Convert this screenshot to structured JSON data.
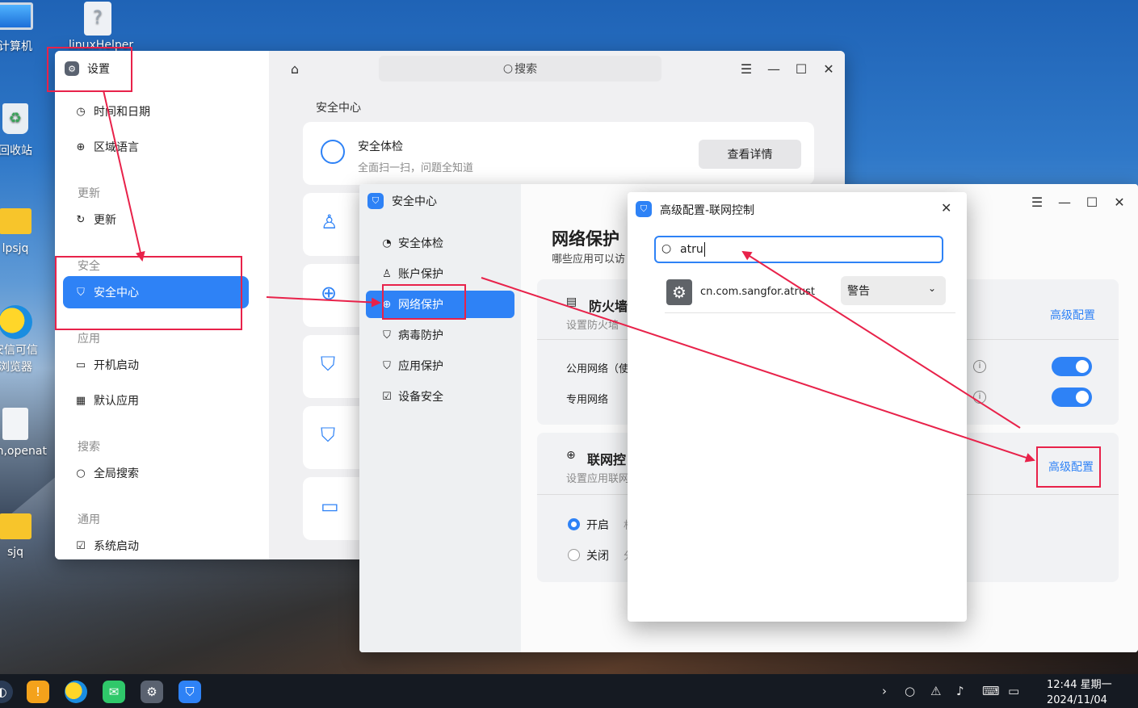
{
  "desktop": {
    "icons": [
      {
        "label": "计算机"
      },
      {
        "label": "linuxHelper"
      },
      {
        "label": "回收站"
      },
      {
        "label": "lpsjq"
      },
      {
        "label": "安信可信浏览器"
      },
      {
        "label": "en,openat"
      },
      {
        "label": "sjq"
      }
    ]
  },
  "settings": {
    "title": "设置",
    "search_placeholder": "搜索",
    "sidebar": {
      "items_top": [
        {
          "label": "时间和日期",
          "icon": "clock-icon"
        },
        {
          "label": "区域语言",
          "icon": "globe-icon"
        }
      ],
      "group_update": "更新",
      "update_item": "更新",
      "group_security": "安全",
      "security_item": "安全中心",
      "group_apps": "应用",
      "app_items": [
        {
          "label": "开机启动",
          "icon": "boot-icon"
        },
        {
          "label": "默认应用",
          "icon": "grid-icon"
        }
      ],
      "group_search": "搜索",
      "search_item": "全局搜索",
      "group_general": "通用",
      "general_item": "系统启动"
    },
    "main": {
      "section_title": "安全中心",
      "checkup": {
        "title": "安全体检",
        "subtitle": "全面扫一扫，问题全知道",
        "button": "查看详情"
      }
    }
  },
  "security_center": {
    "title": "安全中心",
    "nav": [
      {
        "label": "安全体检",
        "icon": "scan-icon"
      },
      {
        "label": "账户保护",
        "icon": "user-icon"
      },
      {
        "label": "网络保护",
        "icon": "globe-icon"
      },
      {
        "label": "病毒防护",
        "icon": "shield-plus-icon"
      },
      {
        "label": "应用保护",
        "icon": "shield-check-icon"
      },
      {
        "label": "设备安全",
        "icon": "device-check-icon"
      }
    ],
    "page_title": "网络保护",
    "page_subtitle": "哪些应用可以访",
    "firewall": {
      "title": "防火墙",
      "subtitle": "设置防火墙",
      "advanced_link": "高级配置",
      "public_network": "公用网络（使",
      "private_network": "专用网络",
      "public_enabled": true,
      "private_enabled": true
    },
    "network_control": {
      "title": "联网控",
      "subtitle": "设置应用联网",
      "advanced_link": "高级配置",
      "option_on": "开启",
      "option_on_suffix": "村",
      "option_off": "关闭",
      "option_off_suffix": "分",
      "selected": "开启"
    }
  },
  "dialog": {
    "title": "高级配置-联网控制",
    "search_value": "atru",
    "row": {
      "app": "cn.com.sangfor.atrust",
      "policy": "警告"
    }
  },
  "taskbar": {
    "time": "12:44 星期一",
    "date": "2024/11/04"
  },
  "colors": {
    "accent": "#2e82f6",
    "annotation": "#e8224a"
  }
}
